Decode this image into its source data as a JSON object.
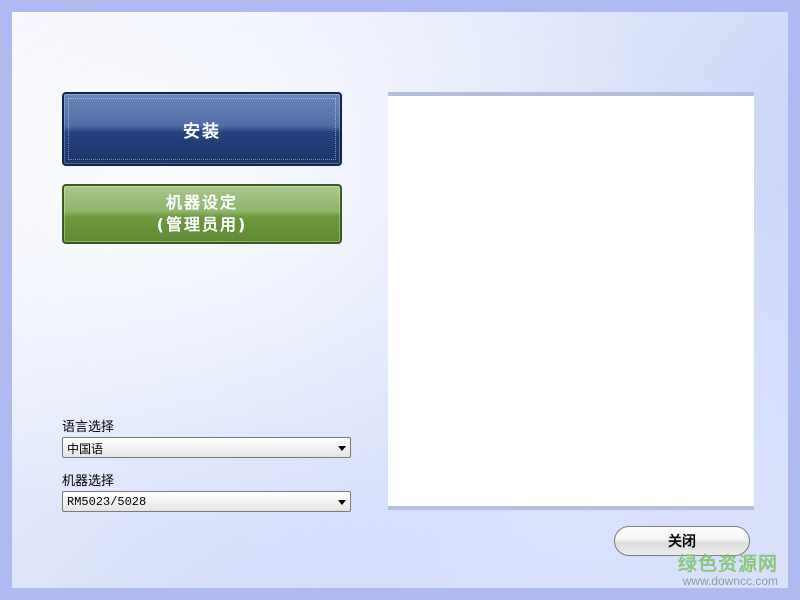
{
  "buttons": {
    "install_label": "安装",
    "settings_label_line1": "机器设定",
    "settings_label_line2": "(管理员用)",
    "close_label": "关闭"
  },
  "language": {
    "label": "语言选择",
    "selected": "中国语"
  },
  "machine": {
    "label": "机器选择",
    "selected": "RM5023/5028"
  },
  "watermark": {
    "text": "绿色资源网",
    "url": "www.downcc.com"
  },
  "colors": {
    "install_button": "#25427f",
    "settings_button": "#6d9a3f",
    "background": "#dfe6fb",
    "watermark_green": "#7cc36a"
  }
}
